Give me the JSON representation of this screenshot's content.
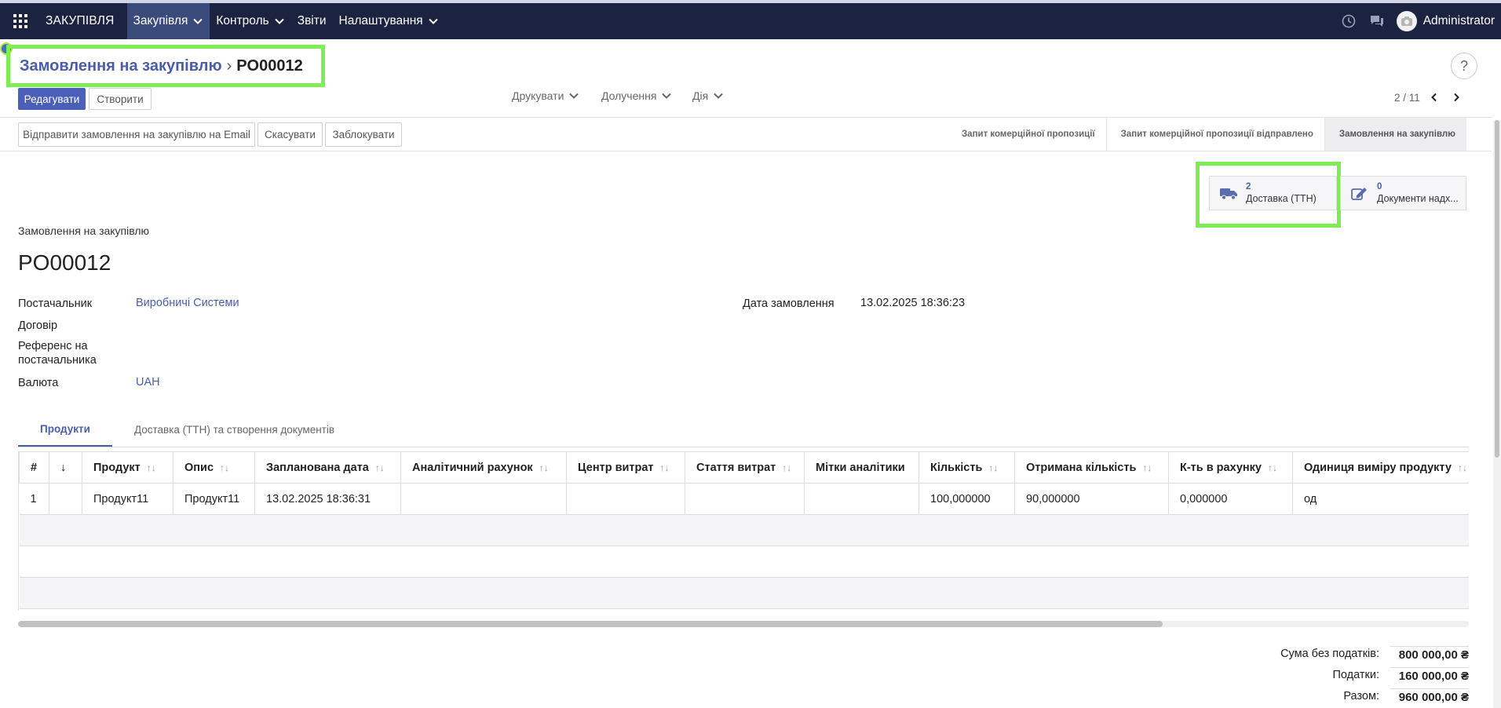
{
  "navbar": {
    "brand": "ЗАКУПІВЛЯ",
    "menu": [
      {
        "label": "Закупівля",
        "active": true,
        "dropdown": true
      },
      {
        "label": "Контроль",
        "active": false,
        "dropdown": true
      },
      {
        "label": "Звіти",
        "active": false,
        "dropdown": false
      },
      {
        "label": "Налаштування",
        "active": false,
        "dropdown": true
      }
    ],
    "user": "Administrator",
    "icons": [
      "apps-icon",
      "clock-icon",
      "chat-icon",
      "avatar"
    ]
  },
  "breadcrumb": {
    "parent": "Замовлення на закупівлю",
    "separator": "›",
    "current": "PO00012"
  },
  "control": {
    "edit_label": "Редагувати",
    "create_label": "Створити",
    "print_label": "Друкувати",
    "receipts_label": "Долучення",
    "action_label": "Дія",
    "pager": "2 / 11",
    "help": "?"
  },
  "header_buttons": {
    "send_email": "Відправити замовлення на закупівлю на Email",
    "cancel": "Скасувати",
    "lock": "Заблокувати"
  },
  "stages": [
    {
      "label": "Запит комерційної пропозиції",
      "current": false
    },
    {
      "label": "Запит комерційної пропозиції відправлено",
      "current": false
    },
    {
      "label": "Замовлення на закупівлю",
      "current": true
    }
  ],
  "smart_buttons": [
    {
      "count": "2",
      "label": "Доставка (ТТН)",
      "icon": "truck-icon"
    },
    {
      "count": "0",
      "label": "Документи надх...",
      "icon": "pencil-square-icon"
    }
  ],
  "form": {
    "doc_label": "Замовлення на закупівлю",
    "name": "PO00012",
    "supplier_label": "Постачальник",
    "supplier_value": "Виробничі Системи",
    "contract_label": "Договір",
    "vendor_ref_label_1": "Референс на",
    "vendor_ref_label_2": "постачальника",
    "currency_label": "Валюта",
    "currency_value": "UAH",
    "order_date_label": "Дата замовлення",
    "order_date_value": "13.02.2025 18:36:23"
  },
  "tabs": [
    {
      "label": "Продукти",
      "active": true
    },
    {
      "label": "Доставка (ТТН) та створення документів",
      "active": false
    }
  ],
  "table": {
    "columns": [
      "#",
      "↓",
      "Продукт",
      "Опис",
      "Запланована дата",
      "Аналітичний рахунок",
      "Центр витрат",
      "Стаття витрат",
      "Мітки аналітики",
      "Кількість",
      "Отримана кількість",
      "К-ть в рахунку",
      "Одиниця виміру продукту"
    ],
    "rows": [
      [
        "1",
        "",
        "Продукт11",
        "Продукт11",
        "13.02.2025 18:36:31",
        "",
        "",
        "",
        "",
        "100,000000",
        "90,000000",
        "0,000000",
        "од"
      ]
    ]
  },
  "totals": {
    "untaxed_label": "Сума без податків:",
    "untaxed_value": "800 000,00 ₴",
    "taxes_label": "Податки:",
    "taxes_value": "160 000,00 ₴",
    "total_label": "Разом:",
    "total_value": "960 000,00 ₴"
  },
  "colors": {
    "navbar": "#1c2340",
    "primary": "#4b5fb8",
    "link": "#4a5da8",
    "highlight": "#7ded52"
  }
}
